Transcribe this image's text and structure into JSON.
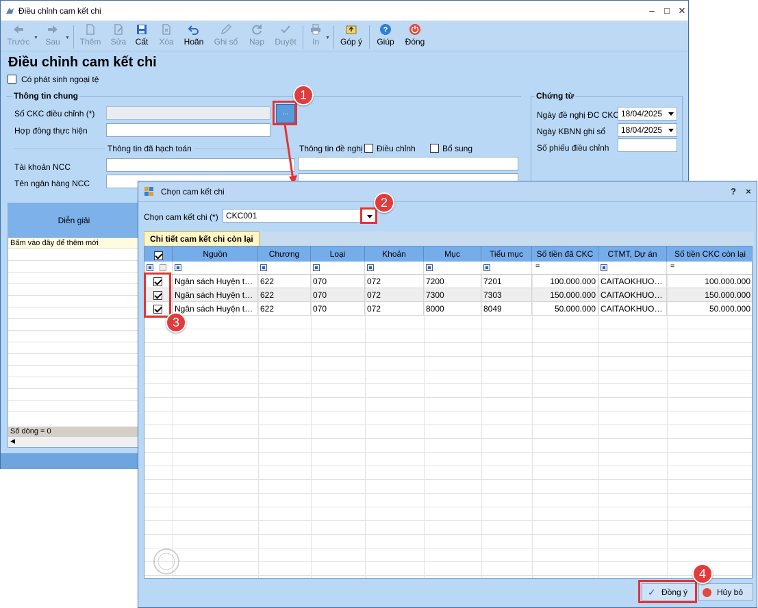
{
  "main_window": {
    "title": "Điều chỉnh cam kết chi",
    "toolbar": [
      {
        "label": "Trước",
        "icon": "arrow-left-icon",
        "enabled": false
      },
      {
        "label": "Sau",
        "icon": "arrow-right-icon",
        "enabled": false
      },
      {
        "label": "Thêm",
        "icon": "add-document-icon",
        "enabled": false
      },
      {
        "label": "Sửa",
        "icon": "edit-document-icon",
        "enabled": false
      },
      {
        "label": "Cất",
        "icon": "save-icon",
        "enabled": true
      },
      {
        "label": "Xóa",
        "icon": "delete-icon",
        "enabled": false
      },
      {
        "label": "Hoãn",
        "icon": "undo-icon",
        "enabled": true
      },
      {
        "label": "Ghi sổ",
        "icon": "pencil-icon",
        "enabled": false
      },
      {
        "label": "Nạp",
        "icon": "refresh-icon",
        "enabled": false
      },
      {
        "label": "Duyệt",
        "icon": "checkmark-icon",
        "enabled": false
      },
      {
        "label": "In",
        "icon": "printer-icon",
        "enabled": false
      },
      {
        "label": "Góp ý",
        "icon": "feedback-icon",
        "enabled": true
      },
      {
        "label": "Giúp",
        "icon": "help-icon",
        "enabled": true
      },
      {
        "label": "Đóng",
        "icon": "power-icon",
        "enabled": true
      }
    ],
    "page_title": "Điều chỉnh cam kết chi",
    "foreign_currency_label": "Có phát sinh ngoại tệ",
    "general_info": {
      "title": "Thông tin chung",
      "ckc_number_label": "Số CKC điều chỉnh (*)",
      "ckc_number_value": "",
      "browse_label": "...",
      "contract_label": "Hợp đồng thực hiện",
      "contract_value": "",
      "accounted_info_label": "Thông tin đã hạch toán",
      "proposed_info_label": "Thông tin đề nghị",
      "adjust_label": "Điều chỉnh",
      "supplement_label": "Bổ sung",
      "supplier_account_label": "Tài khoản NCC",
      "supplier_bank_label": "Tên ngân hàng NCC"
    },
    "voucher": {
      "title": "Chứng từ",
      "request_date_label": "Ngày đề nghị ĐC CKC",
      "request_date_value": "18/04/2025",
      "kbnn_date_label": "Ngày KBNN ghi sổ",
      "kbnn_date_value": "18/04/2025",
      "slip_number_label": "Số phiếu điều chỉnh",
      "slip_number_value": ""
    },
    "left_grid": {
      "header": "Diễn giải",
      "new_row_text": "Bấm vào đây để thêm mới",
      "row_count_text": "Số dòng = 0"
    }
  },
  "dialog": {
    "title": "Chọn cam kết chi",
    "help": "?",
    "close": "×",
    "select_label": "Chọn cam kết chi (*)",
    "select_value": "CKC001",
    "tab_label": "Chi tiết cam kết chi còn lại",
    "columns": [
      "Nguồn",
      "Chương",
      "Loại",
      "Khoản",
      "Mục",
      "Tiểu mục",
      "Số tiền đã CKC",
      "CTMT, Dự án",
      "Số tiền CKC còn lại"
    ],
    "rows": [
      {
        "checked": true,
        "nguon": "Ngân sách Huyện tự chủ",
        "chuong": "622",
        "loai": "070",
        "khoan": "072",
        "muc": "7200",
        "tieu_muc": "7201",
        "so_tien_da_ckc": "100.000.000",
        "ctmt": "CAITAOKHUONVIEN",
        "so_tien_con_lai": "100.000.000"
      },
      {
        "checked": true,
        "nguon": "Ngân sách Huyện tự chủ",
        "chuong": "622",
        "loai": "070",
        "khoan": "072",
        "muc": "7300",
        "tieu_muc": "7303",
        "so_tien_da_ckc": "150.000.000",
        "ctmt": "CAITAOKHUONVIEN",
        "so_tien_con_lai": "150.000.000"
      },
      {
        "checked": true,
        "nguon": "Ngân sách Huyện tự chủ",
        "chuong": "622",
        "loai": "070",
        "khoan": "072",
        "muc": "8000",
        "tieu_muc": "8049",
        "so_tien_da_ckc": "50.000.000",
        "ctmt": "CAITAOKHUONVIEN",
        "so_tien_con_lai": "50.000.000"
      }
    ],
    "ok_label": "Đồng ý",
    "cancel_label": "Hủy bỏ"
  },
  "annotations": [
    "1",
    "2",
    "3",
    "4"
  ],
  "colors": {
    "accent": "#75acea",
    "annotation": "#e23b3b",
    "window": "#b9d8f6"
  }
}
